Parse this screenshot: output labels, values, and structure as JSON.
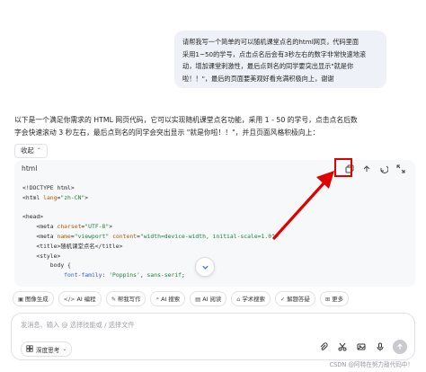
{
  "user_message": {
    "lines": [
      "请帮我写一个简单的可以随机课堂点名的html网页，代码里面",
      "采用1~50的学号，点击点名后会有3秒左右的数字非常快速地滚",
      "动，增加课堂刺激性，最后点到名的同学要突出显示\"就是你",
      "啦！！\"，最后的页面要美观好看充满积极向上，谢谢"
    ]
  },
  "assistant": {
    "intro_lines": [
      "以下是一个满足你需求的 HTML 网页代码，它可以实现随机课堂点名功能，采用 1 - 50 的学号，点击点名后数",
      "字会快速滚动 3 秒左右，最后点到名的同学会突出显示 \"就是你啦！！\"，并且页面风格积极向上："
    ],
    "collapse_label": "收起"
  },
  "code_block": {
    "language": "html",
    "lines": [
      {
        "indent": 0,
        "parts": [
          {
            "t": "tag",
            "v": "<!DOCTYPE html>"
          }
        ]
      },
      {
        "indent": 0,
        "parts": [
          {
            "t": "tag",
            "v": "<html "
          },
          {
            "t": "attr",
            "v": "lang"
          },
          {
            "t": "tag",
            "v": "="
          },
          {
            "t": "str",
            "v": "\"zh-CN\""
          },
          {
            "t": "tag",
            "v": ">"
          }
        ]
      },
      {
        "indent": 0,
        "parts": []
      },
      {
        "indent": 0,
        "parts": [
          {
            "t": "tag",
            "v": "<head>"
          }
        ]
      },
      {
        "indent": 1,
        "parts": [
          {
            "t": "tag",
            "v": "<meta "
          },
          {
            "t": "attr",
            "v": "charset"
          },
          {
            "t": "tag",
            "v": "="
          },
          {
            "t": "str",
            "v": "\"UTF-8\""
          },
          {
            "t": "tag",
            "v": ">"
          }
        ]
      },
      {
        "indent": 1,
        "parts": [
          {
            "t": "tag",
            "v": "<meta "
          },
          {
            "t": "attr",
            "v": "name"
          },
          {
            "t": "tag",
            "v": "="
          },
          {
            "t": "str",
            "v": "\"viewport\""
          },
          {
            "t": "tag",
            "v": " "
          },
          {
            "t": "attr",
            "v": "content"
          },
          {
            "t": "tag",
            "v": "="
          },
          {
            "t": "str",
            "v": "\"width=device-width, initial-scale=1.0\""
          },
          {
            "t": "tag",
            "v": ">"
          }
        ]
      },
      {
        "indent": 1,
        "parts": [
          {
            "t": "tag",
            "v": "<title>随机课堂点名</title>"
          }
        ]
      },
      {
        "indent": 1,
        "parts": [
          {
            "t": "tag",
            "v": "<style>"
          }
        ]
      },
      {
        "indent": 2,
        "parts": [
          {
            "t": "tag",
            "v": "body {"
          }
        ]
      },
      {
        "indent": 3,
        "parts": [
          {
            "t": "prop",
            "v": "font-family"
          },
          {
            "t": "tag",
            "v": ": "
          },
          {
            "t": "str",
            "v": "'Poppins'"
          },
          {
            "t": "tag",
            "v": ", "
          },
          {
            "t": "str",
            "v": "sans-serif"
          },
          {
            "t": "tag",
            "v": ";"
          }
        ]
      }
    ]
  },
  "toolbar_chips": [
    {
      "icon": "image-icon",
      "glyph": "▣",
      "label": "图像生成"
    },
    {
      "icon": "code-icon",
      "glyph": "</>",
      "label": "AI 编程"
    },
    {
      "icon": "pen-icon",
      "glyph": "✎",
      "label": "帮我写作"
    },
    {
      "icon": "search-icon",
      "glyph": "⌕",
      "label": "AI 搜索"
    },
    {
      "icon": "read-icon",
      "glyph": "▤",
      "label": "AI 阅读"
    },
    {
      "icon": "academic-icon",
      "glyph": "⌂",
      "label": "学术搜索"
    },
    {
      "icon": "solve-icon",
      "glyph": "✓",
      "label": "解题答疑"
    },
    {
      "icon": "more-icon",
      "glyph": "⊞",
      "label": "更多"
    }
  ],
  "input": {
    "placeholder": "发消息、输入 @ 选择技能或 / 选择文件",
    "deep_think_label": "深度思考"
  },
  "watermark": "CSDN @阿特在努力敲代码中！",
  "colors": {
    "highlight": "#e00000",
    "bubble": "#eef1f7",
    "code_bg": "#f7f8fa"
  }
}
